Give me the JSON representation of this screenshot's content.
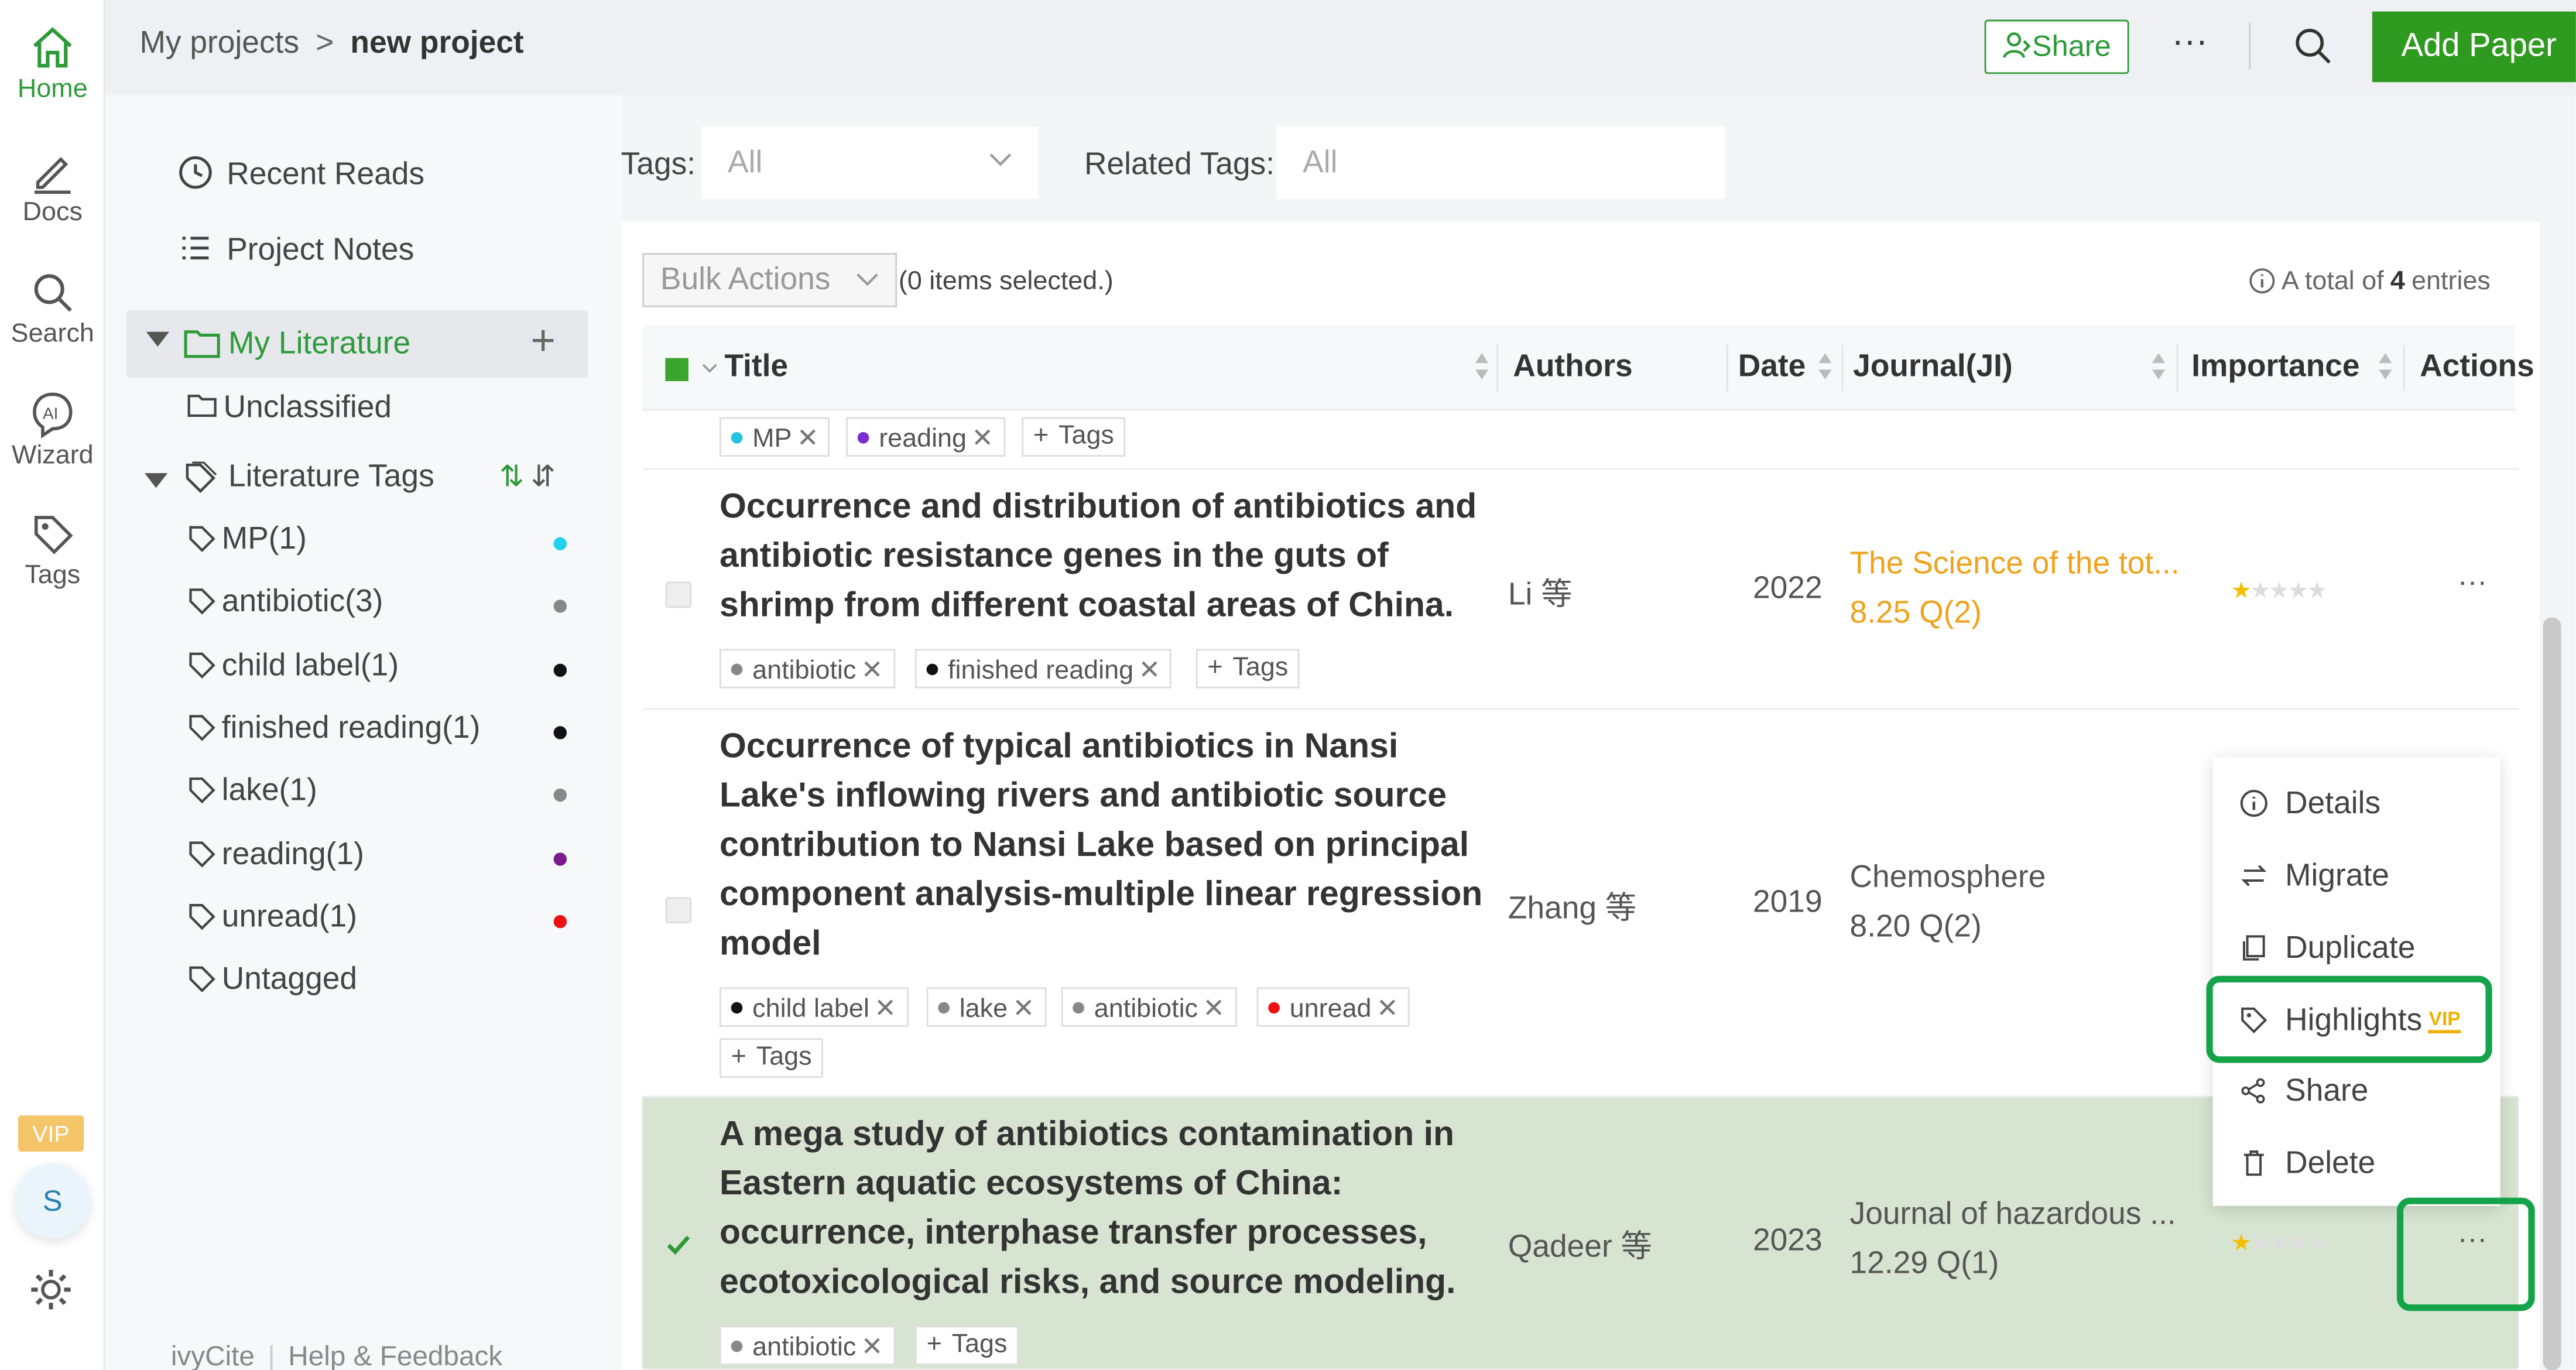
{
  "rail": {
    "home": "Home",
    "docs": "Docs",
    "search": "Search",
    "wizard": "Wizard",
    "tags": "Tags",
    "vip": "VIP",
    "avatar": "S"
  },
  "topbar": {
    "crumb_root": "My projects",
    "crumb_sep": ">",
    "crumb_current": "new project",
    "share": "Share",
    "more": "···",
    "add_paper": "Add Paper"
  },
  "sidebar": {
    "recent_reads": "Recent Reads",
    "project_notes": "Project Notes",
    "my_literature": "My Literature",
    "unclassified": "Unclassified",
    "literature_tags": "Literature Tags",
    "tags": [
      {
        "label": "MP(1)",
        "color": "#22d3ee"
      },
      {
        "label": "antibiotic(3)",
        "color": "#888888"
      },
      {
        "label": "child label(1)",
        "color": "#111111"
      },
      {
        "label": "finished reading(1)",
        "color": "#111111"
      },
      {
        "label": "lake(1)",
        "color": "#888888"
      },
      {
        "label": "reading(1)",
        "color": "#7a1a8c"
      },
      {
        "label": "unread(1)",
        "color": "#ee1111"
      }
    ],
    "untagged": "Untagged",
    "footer_brand": "ivyCite",
    "footer_help": "Help & Feedback"
  },
  "filters": {
    "tags_label": "Tags:",
    "tags_value": "All",
    "related_label": "Related Tags:",
    "related_value": "All"
  },
  "table": {
    "bulk_actions": "Bulk Actions",
    "selected_note": "(0 items selected.)",
    "total_prefix": "A total of",
    "total_count": "4",
    "total_suffix": "entries",
    "columns": {
      "title": "Title",
      "authors": "Authors",
      "date": "Date",
      "journal": "Journal(JI)",
      "importance": "Importance",
      "actions": "Actions"
    },
    "partial_row_tags": [
      "MP",
      "reading"
    ],
    "add_tags": "Tags",
    "rows": [
      {
        "title": "Occurrence and distribution of antibiotics and antibiotic resistance genes in the guts of shrimp from different coastal areas of China.",
        "authors": "Li 等",
        "date": "2022",
        "journal": "The Science of the tot...",
        "journal_metric": "8.25 Q(2)",
        "stars": 1,
        "tags": [
          "antibiotic",
          "finished reading"
        ]
      },
      {
        "title": "Occurrence of typical antibiotics in Nansi Lake's inflowing rivers and antibiotic source contribution to Nansi Lake based on principal component analysis-multiple linear regression model",
        "authors": "Zhang 等",
        "date": "2019",
        "journal": "Chemosphere",
        "journal_metric": "8.20 Q(2)",
        "stars": 0,
        "tags": [
          "child label",
          "lake",
          "antibiotic",
          "unread"
        ]
      },
      {
        "title": "A mega study of antibiotics contamination in Eastern aquatic ecosystems of China: occurrence, interphase transfer processes, ecotoxicological risks, and source modeling.",
        "authors": "Qadeer 等",
        "date": "2023",
        "journal": "Journal of hazardous ...",
        "journal_metric": "12.29 Q(1)",
        "stars": 1,
        "tags": [
          "antibiotic"
        ]
      }
    ]
  },
  "context_menu": {
    "details": "Details",
    "migrate": "Migrate",
    "duplicate": "Duplicate",
    "highlights": "Highlights",
    "vip": "VIP",
    "share": "Share",
    "delete": "Delete"
  },
  "row_more": "···"
}
